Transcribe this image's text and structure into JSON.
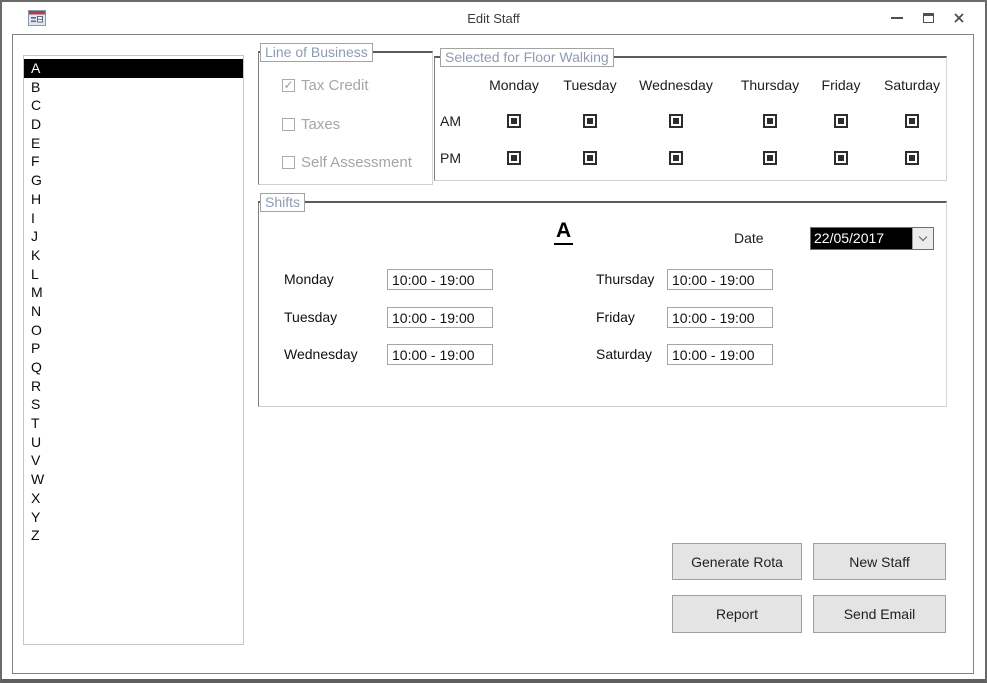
{
  "window": {
    "title": "Edit Staff",
    "icon": "access-form-icon",
    "controls": [
      {
        "name": "minimize",
        "icon": "minimize-icon"
      },
      {
        "name": "maximize",
        "icon": "maximize-icon"
      },
      {
        "name": "close",
        "icon": "close-icon"
      }
    ]
  },
  "staff_list": {
    "items": [
      "A",
      "B",
      "C",
      "D",
      "E",
      "F",
      "G",
      "H",
      "I",
      "J",
      "K",
      "L",
      "M",
      "N",
      "O",
      "P",
      "Q",
      "R",
      "S",
      "T",
      "U",
      "V",
      "W",
      "X",
      "Y",
      "Z"
    ],
    "selected": "A"
  },
  "line_of_business": {
    "label": "Line of Business",
    "options": [
      {
        "label": "Tax Credit",
        "checked": true
      },
      {
        "label": "Taxes",
        "checked": false
      },
      {
        "label": "Self Assessment",
        "checked": false
      }
    ]
  },
  "floor_walking": {
    "label": "Selected for Floor Walking",
    "days": [
      "Monday",
      "Tuesday",
      "Wednesday",
      "Thursday",
      "Friday",
      "Saturday"
    ],
    "rows": [
      {
        "label": "AM",
        "checked": [
          true,
          true,
          true,
          true,
          true,
          true
        ]
      },
      {
        "label": "PM",
        "checked": [
          true,
          true,
          true,
          true,
          true,
          true
        ]
      }
    ]
  },
  "shifts": {
    "label": "Shifts",
    "staff_initial": "A",
    "date_label": "Date",
    "date_value": "22/05/2017",
    "entries_left": [
      {
        "day": "Monday",
        "time": "10:00 - 19:00"
      },
      {
        "day": "Tuesday",
        "time": "10:00 - 19:00"
      },
      {
        "day": "Wednesday",
        "time": "10:00 - 19:00"
      }
    ],
    "entries_right": [
      {
        "day": "Thursday",
        "time": "10:00 - 19:00"
      },
      {
        "day": "Friday",
        "time": "10:00 - 19:00"
      },
      {
        "day": "Saturday",
        "time": "10:00 - 19:00"
      }
    ]
  },
  "buttons": {
    "generate_rota": "Generate Rota",
    "new_staff": "New Staff",
    "report": "Report",
    "send_email": "Send Email"
  },
  "colors": {
    "selection_bg": "#000000",
    "selection_fg": "#ffffff",
    "group_label": "#8d9cb2",
    "disabled_text": "#a6a6a6",
    "button_bg": "#e4e4e4",
    "button_border": "#9f9f9f",
    "checkbox_fill": "#2d2d2d"
  }
}
